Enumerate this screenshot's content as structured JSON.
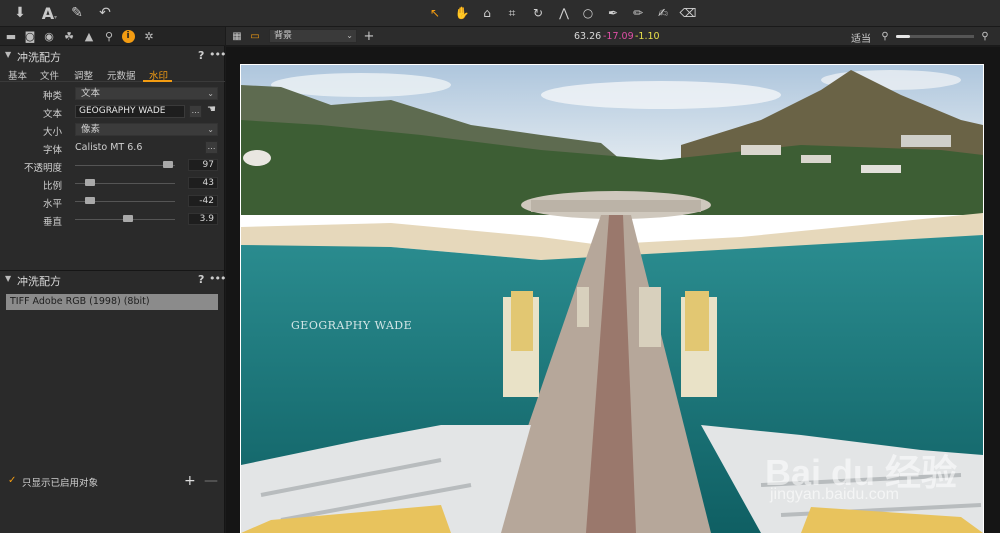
{
  "toolbar": {
    "icons": [
      "import-icon",
      "text-tool-icon",
      "brush-icon",
      "undo-icon"
    ],
    "tools": [
      "pointer-tool",
      "hand-tool",
      "loupe-tool",
      "crop-tool",
      "rotate-tool",
      "keystone-tool",
      "spot-tool",
      "pen-tool",
      "pencil-tool",
      "brush-tool",
      "eraser-tool"
    ]
  },
  "left_panel": {
    "tabs": [
      "folder-icon",
      "camera-icon",
      "color-icon",
      "layers-icon",
      "exposure-icon",
      "details-icon",
      "metadata-icon",
      "output-icon",
      "settings-icon"
    ],
    "section1": {
      "title": "冲洗配方",
      "help": "?",
      "more": "•••",
      "subtabs": [
        "基本",
        "文件",
        "调整",
        "元数据",
        "水印"
      ],
      "rows": {
        "kind": {
          "label": "种类",
          "value": "文本"
        },
        "text": {
          "label": "文本",
          "value": "GEOGRAPHY WADE",
          "more": "…"
        },
        "size": {
          "label": "大小",
          "value": "像素"
        },
        "font": {
          "label": "字体",
          "value": "Calisto MT 6.6",
          "more": "…"
        }
      },
      "sliders": [
        {
          "label": "不透明度",
          "value": "97",
          "position": 0.93
        },
        {
          "label": "比例",
          "value": "43",
          "position": 0.15
        },
        {
          "label": "水平",
          "value": "-42",
          "position": 0.15
        },
        {
          "label": "垂直",
          "value": "3.9",
          "position": 0.53
        }
      ]
    },
    "section2": {
      "title": "冲洗配方",
      "help": "?",
      "more": "•••",
      "icc": "TIFF Adobe RGB (1998) (8bit)"
    },
    "bottom": {
      "checkbox_label": "只显示已启用对象",
      "checked": true,
      "plus": "+",
      "minus": "—"
    }
  },
  "viewer_bar": {
    "background_select": "背景",
    "coords": [
      {
        "value": "63.26",
        "color": "#d8d8d8"
      },
      {
        "value": "-17.09",
        "color": "#e04fa7"
      },
      {
        "value": "-1.10",
        "color": "#e8e04a"
      }
    ],
    "fit_label": "适当",
    "zoom_fraction": 0.18
  },
  "viewer": {
    "watermark_text": "GEOGRAPHY WADE",
    "baidu_logo_text": "Bai du 经验",
    "baidu_url": "jingyan.baidu.com"
  }
}
